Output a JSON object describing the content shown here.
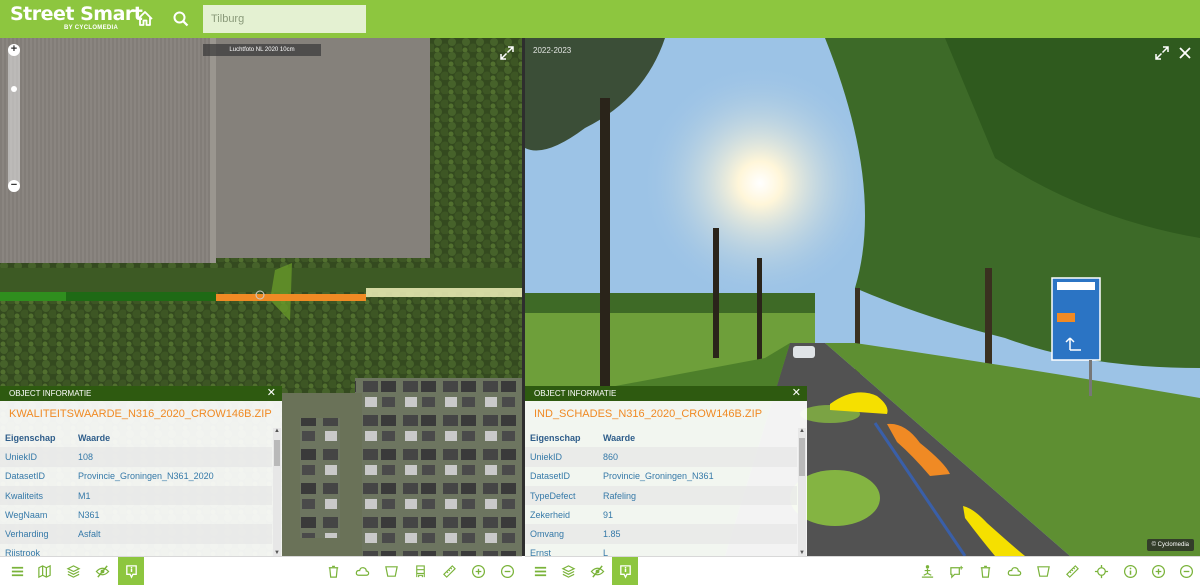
{
  "header": {
    "logo_main": "Street Smart",
    "logo_sub": "BY CYCLOMEDIA",
    "search_placeholder": "Tilburg",
    "accent_color": "#8dc63f"
  },
  "left_pane": {
    "map_source_label": "Luchtfoto NL 2020 10cm",
    "info_panel": {
      "header": "OBJECT INFORMATIE",
      "title": "KWALITEITSWAARDE_N316_2020_CROW146B.ZIP",
      "col_key": "Eigenschap",
      "col_value": "Waarde",
      "rows": [
        {
          "key": "UniekID",
          "value": "108"
        },
        {
          "key": "DatasetID",
          "value": "Provincie_Groningen_N361_2020"
        },
        {
          "key": "Kwaliteits",
          "value": "M1"
        },
        {
          "key": "WegNaam",
          "value": "N361"
        },
        {
          "key": "Verharding",
          "value": "Asfalt"
        },
        {
          "key": "Rijstrook",
          "value": ""
        }
      ]
    }
  },
  "right_pane": {
    "capture_date": "2022-2023",
    "copyright": "© Cyclomedia",
    "info_panel": {
      "header": "OBJECT INFORMATIE",
      "title": "IND_SCHADES_N316_2020_CROW146B.ZIP",
      "col_key": "Eigenschap",
      "col_value": "Waarde",
      "rows": [
        {
          "key": "UniekID",
          "value": "860"
        },
        {
          "key": "DatasetID",
          "value": "Provincie_Groningen_N361"
        },
        {
          "key": "TypeDefect",
          "value": "Rafeling"
        },
        {
          "key": "Zekerheid",
          "value": "91"
        },
        {
          "key": "Omvang",
          "value": "1.85"
        },
        {
          "key": "Ernst",
          "value": "L"
        }
      ]
    }
  },
  "toolbar_left": [
    "menu-icon",
    "map-icon",
    "layers-icon",
    "visibility-off-icon",
    "object-info-icon",
    "delete-icon",
    "cloud-icon",
    "area-icon",
    "building-icon",
    "measure-icon",
    "zoom-in-icon",
    "zoom-out-icon"
  ],
  "toolbar_right": [
    "menu-icon",
    "layers-icon",
    "visibility-off-icon",
    "object-info-icon",
    "person-height-icon",
    "comment-icon",
    "delete-icon",
    "cloud-icon",
    "area-icon",
    "measure-icon",
    "navigate-icon",
    "info-icon",
    "zoom-in-icon",
    "zoom-out-icon"
  ]
}
